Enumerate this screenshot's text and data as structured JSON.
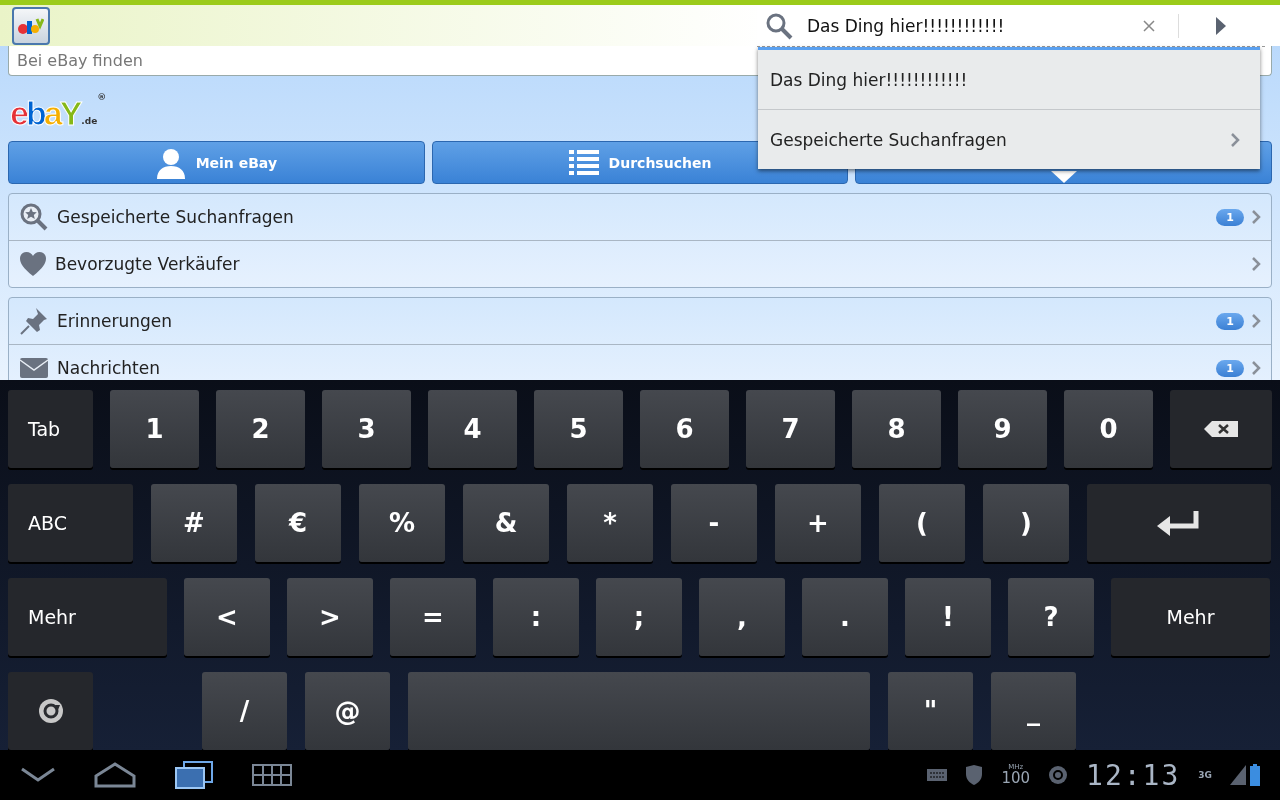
{
  "header": {
    "search_value": "Das Ding hier!!!!!!!!!!!!"
  },
  "page_search": {
    "placeholder": "Bei eBay finden"
  },
  "suggestions": [
    {
      "label": "Das Ding hier!!!!!!!!!!!!",
      "kind": "query"
    },
    {
      "label": "Gespeicherte Suchanfragen",
      "kind": "link"
    }
  ],
  "logo": {
    "letters": [
      {
        "char": "e",
        "color": "#e53238"
      },
      {
        "char": "b",
        "color": "#0064d2"
      },
      {
        "char": "a",
        "color": "#f5af02"
      },
      {
        "char": "Y",
        "color": "#86b817"
      }
    ],
    "domain": ".de",
    "mark": "®"
  },
  "nav_buttons": [
    {
      "label": "Mein eBay",
      "kind": "person"
    },
    {
      "label": "Durchsuchen",
      "kind": "list"
    },
    {
      "kind": "tag"
    }
  ],
  "groups": [
    [
      {
        "label": "Gespeicherte Suchanfragen",
        "kind": "saved-search",
        "badge": "1"
      },
      {
        "label": "Bevorzugte Verkäufer",
        "kind": "favorite"
      }
    ],
    [
      {
        "label": "Erinnerungen",
        "kind": "reminder",
        "badge": "1"
      },
      {
        "label": "Nachrichten",
        "kind": "message",
        "badge": "1"
      }
    ]
  ],
  "keyboard": {
    "rows": [
      [
        {
          "label": "Tab",
          "kind": "fn"
        },
        {
          "label": "1",
          "kind": "char"
        },
        {
          "label": "2",
          "kind": "char"
        },
        {
          "label": "3",
          "kind": "char"
        },
        {
          "label": "4",
          "kind": "char"
        },
        {
          "label": "5",
          "kind": "char"
        },
        {
          "label": "6",
          "kind": "char"
        },
        {
          "label": "7",
          "kind": "char"
        },
        {
          "label": "8",
          "kind": "char"
        },
        {
          "label": "9",
          "kind": "char"
        },
        {
          "label": "0",
          "kind": "char"
        },
        {
          "kind": "backspace"
        }
      ],
      [
        {
          "label": "ABC",
          "kind": "fn"
        },
        {
          "label": "#",
          "kind": "char"
        },
        {
          "label": "€",
          "kind": "char"
        },
        {
          "label": "%",
          "kind": "char"
        },
        {
          "label": "&",
          "kind": "char"
        },
        {
          "label": "*",
          "kind": "char"
        },
        {
          "label": "-",
          "kind": "char"
        },
        {
          "label": "+",
          "kind": "char"
        },
        {
          "label": "(",
          "kind": "char"
        },
        {
          "label": ")",
          "kind": "char"
        },
        {
          "kind": "enter"
        }
      ],
      [
        {
          "label": "Mehr",
          "kind": "fn"
        },
        {
          "label": "<",
          "kind": "char"
        },
        {
          "label": ">",
          "kind": "char"
        },
        {
          "label": "=",
          "kind": "char"
        },
        {
          "label": ":",
          "kind": "char"
        },
        {
          "label": ";",
          "kind": "char"
        },
        {
          "label": ",",
          "kind": "char"
        },
        {
          "label": ".",
          "kind": "char"
        },
        {
          "label": "!",
          "kind": "char"
        },
        {
          "label": "?",
          "kind": "char"
        },
        {
          "label": "Mehr",
          "kind": "fn"
        }
      ],
      [
        {
          "kind": "settings"
        },
        {
          "label": "/",
          "kind": "char"
        },
        {
          "label": "@",
          "kind": "char"
        },
        {
          "kind": "space"
        },
        {
          "label": "\"",
          "kind": "char"
        },
        {
          "label": "_",
          "kind": "char"
        }
      ]
    ]
  },
  "status_bar": {
    "speed_unit": "MHz",
    "speed": "100",
    "time": "12:13",
    "network": "3G"
  }
}
